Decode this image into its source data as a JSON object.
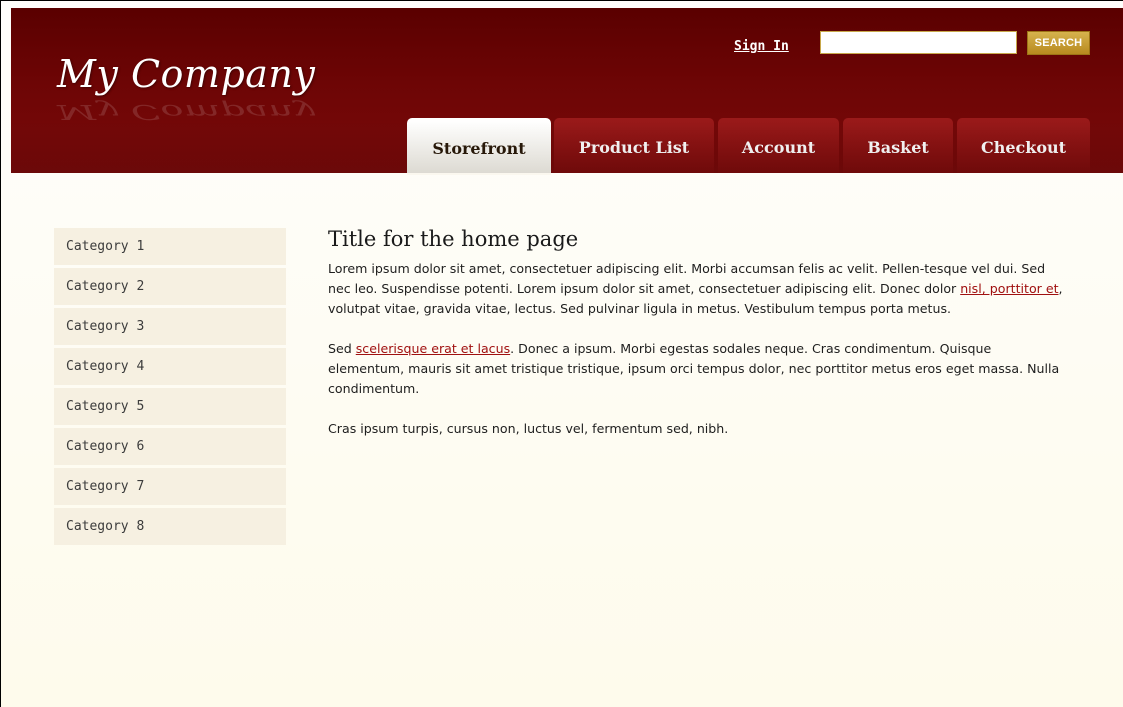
{
  "header": {
    "logo": "My Company",
    "signin_label": "Sign In",
    "search": {
      "value": "",
      "placeholder": "",
      "button_label": "SEARCH"
    }
  },
  "tabs": [
    {
      "label": "Storefront",
      "active": true
    },
    {
      "label": "Product List"
    },
    {
      "label": "Account"
    },
    {
      "label": "Basket"
    },
    {
      "label": "Checkout"
    }
  ],
  "sidebar": {
    "items": [
      {
        "label": "Category 1"
      },
      {
        "label": "Category 2"
      },
      {
        "label": "Category 3"
      },
      {
        "label": "Category 4"
      },
      {
        "label": "Category 5"
      },
      {
        "label": "Category 6"
      },
      {
        "label": "Category 7"
      },
      {
        "label": "Category 8"
      }
    ]
  },
  "main": {
    "title": "Title for the home page",
    "p1": {
      "before": "Lorem ipsum dolor sit amet, consectetuer adipiscing elit. Morbi accumsan felis ac velit. Pellen-tesque vel dui. Sed nec leo. Suspendisse potenti. Lorem ipsum dolor sit amet, consectetuer adipiscing elit. Donec dolor ",
      "link": "nisl, porttitor et",
      "after": ", volutpat vitae, gravida vitae, lectus. Sed pulvinar ligula in metus. Vestibulum tempus porta metus."
    },
    "p2": {
      "before": "Sed ",
      "link": "scelerisque erat et lacus",
      "after": ". Donec a ipsum. Morbi egestas sodales neque. Cras condimentum. Quisque elementum, mauris sit amet tristique tristique, ipsum orci tempus dolor, nec porttitor metus eros eget massa. Nulla condimentum."
    },
    "p3": "Cras ipsum turpis, cursus non, luctus vel, fermentum sed, nibh."
  },
  "colors": {
    "header_bg": "#6d0505",
    "tab_bg": "#8e1414",
    "link": "#a01010",
    "sidebar_item_bg": "#f6f0e1",
    "search_button": "#c9a034"
  }
}
